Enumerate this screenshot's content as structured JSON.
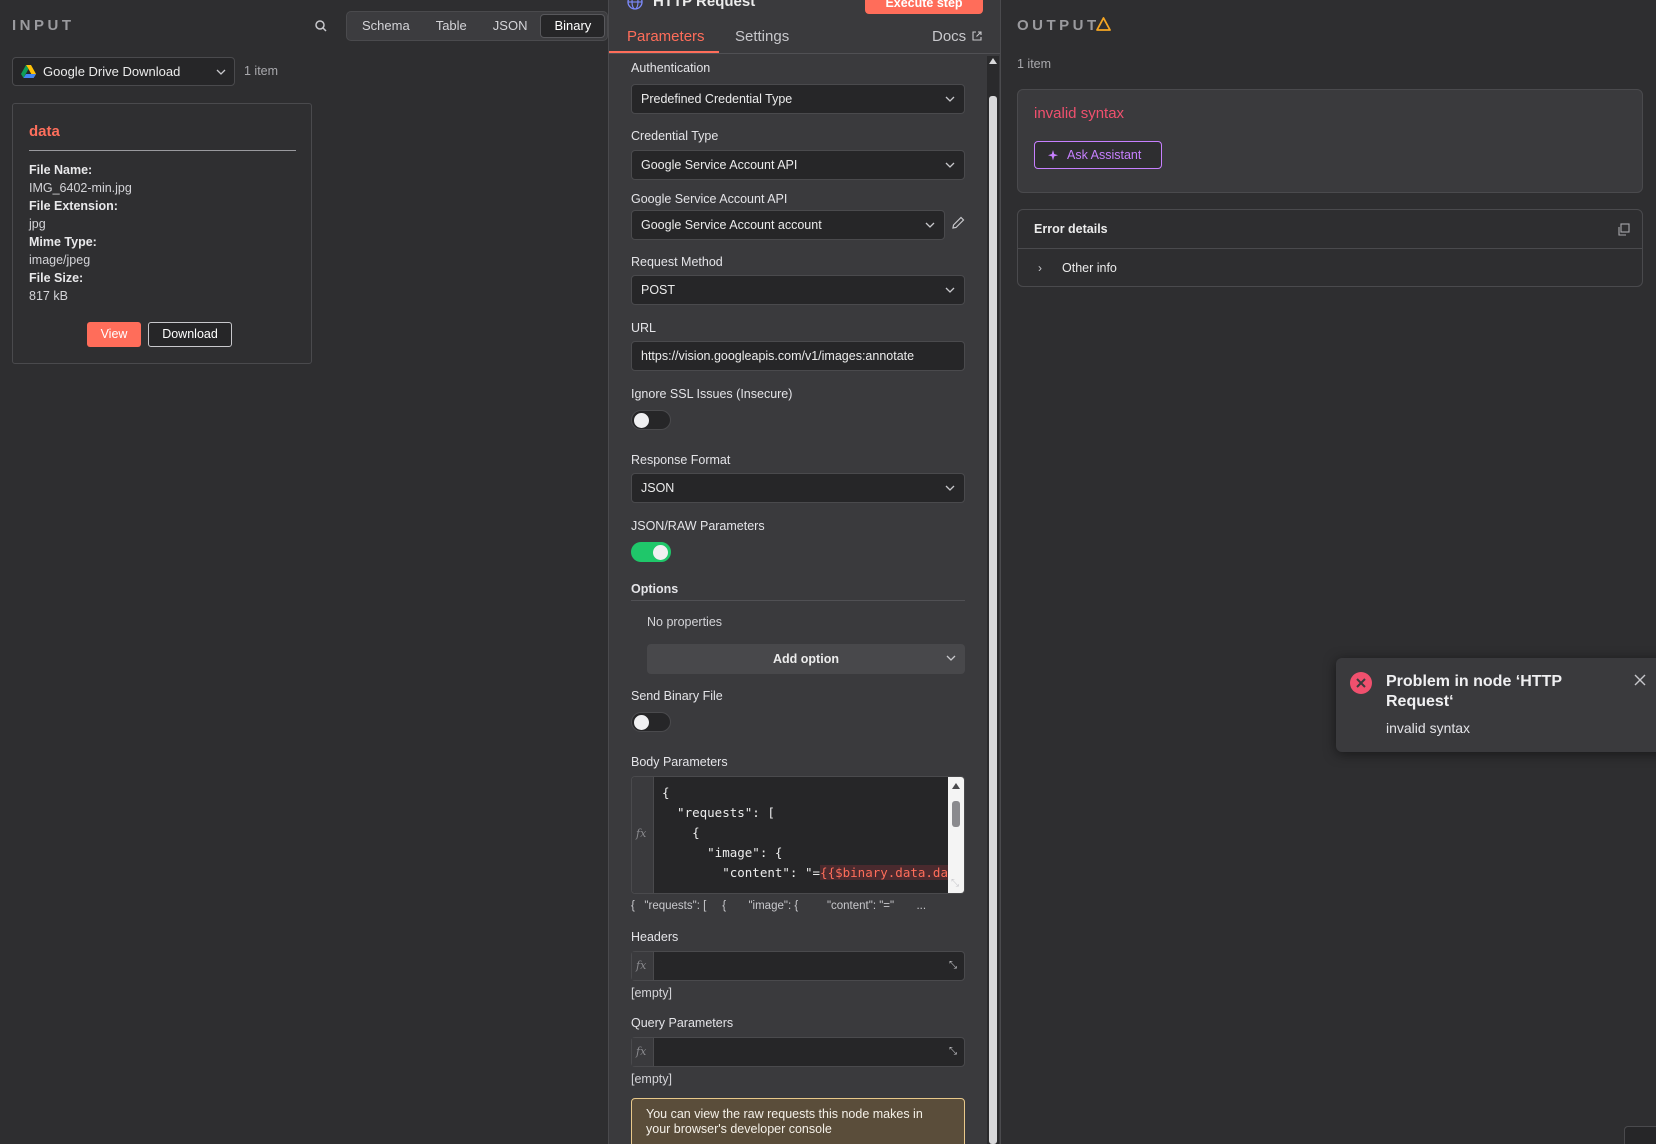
{
  "input": {
    "title": "INPUT",
    "tabs": [
      {
        "label": "Schema"
      },
      {
        "label": "Table"
      },
      {
        "label": "JSON"
      },
      {
        "label": "Binary"
      }
    ],
    "active_tab": "Binary",
    "node_select": "Google Drive Download",
    "item_count": "1 item",
    "binary": {
      "title": "data",
      "file_name_label": "File Name:",
      "file_name": "IMG_6402-min.jpg",
      "file_ext_label": "File Extension:",
      "file_ext": "jpg",
      "mime_label": "Mime Type:",
      "mime": "image/jpeg",
      "size_label": "File Size:",
      "size": "817 kB",
      "view_label": "View",
      "download_label": "Download"
    }
  },
  "node": {
    "title": "HTTP Request",
    "execute_label": "Execute step",
    "tabs": {
      "parameters": "Parameters",
      "settings": "Settings",
      "docs": "Docs"
    },
    "fields": {
      "auth_label": "Authentication",
      "auth_value": "Predefined Credential Type",
      "cred_type_label": "Credential Type",
      "cred_type_value": "Google Service Account API",
      "gsa_label": "Google Service Account API",
      "gsa_value": "Google Service Account account",
      "method_label": "Request Method",
      "method_value": "POST",
      "url_label": "URL",
      "url_value": "https://vision.googleapis.com/v1/images:annotate",
      "ssl_label": "Ignore SSL Issues (Insecure)",
      "ssl_on": false,
      "response_label": "Response Format",
      "response_value": "JSON",
      "jsonraw_label": "JSON/RAW Parameters",
      "jsonraw_on": true,
      "options_label": "Options",
      "no_properties": "No properties",
      "add_option": "Add option",
      "send_binary_label": "Send Binary File",
      "send_binary_on": false,
      "body_label": "Body Parameters",
      "body_code_lines": [
        "{",
        "  \"requests\": [",
        "    {",
        "      \"image\": {",
        "        \"content\": \"="
      ],
      "body_code_expr": "{{$binary.data.data}}",
      "body_code_expr_tail": "\"",
      "body_preview": "{   \"requests\": [     {       \"image\": {         \"content\": \"=\"       ...",
      "headers_label": "Headers",
      "headers_empty": "[empty]",
      "query_label": "Query Parameters",
      "query_empty": "[empty]",
      "info_text": "You can view the raw requests this node makes in your browser's developer console",
      "fx": "fx"
    }
  },
  "output": {
    "title": "OUTPUT",
    "item_count": "1 item",
    "error_title": "invalid syntax",
    "ask_assistant": "Ask Assistant",
    "details_title": "Error details",
    "other_info": "Other info"
  },
  "toast": {
    "title": "Problem in node ‘HTTP Request‘",
    "message": "invalid syntax"
  },
  "colors": {
    "accent": "#ff6d5a",
    "error": "#f0506e",
    "assistant": "#c780ff",
    "toggle_on": "#1fc76a",
    "warning": "#f5a623"
  }
}
